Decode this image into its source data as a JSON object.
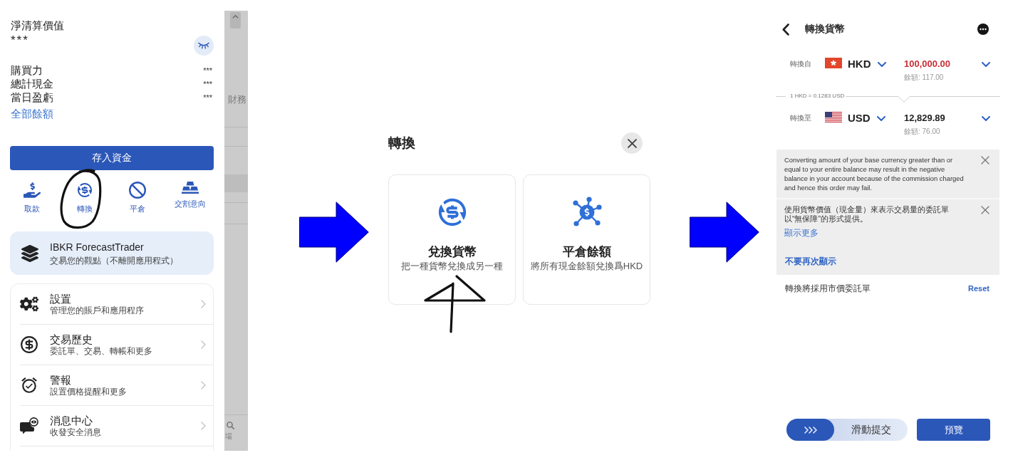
{
  "account_drawer": {
    "title": "淨清算價值",
    "masked_value": "***",
    "balances": [
      {
        "label": "購買力",
        "value": "***"
      },
      {
        "label": "總計現金",
        "value": "***"
      },
      {
        "label": "當日盈虧",
        "value": "***"
      }
    ],
    "all_balances_link": "全部餘額",
    "deposit_button": "存入資金",
    "actions": [
      {
        "label": "取款"
      },
      {
        "label": "轉換"
      },
      {
        "label": "平倉"
      },
      {
        "label": "交割意向"
      }
    ],
    "promo": {
      "title": "IBKR ForecastTrader",
      "subtitle": "交易您的觀點（不離開應用程式）"
    },
    "menu": [
      {
        "title": "設置",
        "subtitle": "管理您的賬戶和應用程序"
      },
      {
        "title": "交易歷史",
        "subtitle": "委託單、交易、轉帳和更多"
      },
      {
        "title": "警報",
        "subtitle": "設置價格提醒和更多"
      },
      {
        "title": "消息中心",
        "subtitle": "收發安全消息"
      }
    ]
  },
  "background_screen": {
    "column_label": "財務",
    "tab_label": "場"
  },
  "convert_dialog": {
    "title": "轉換",
    "options": [
      {
        "title": "兌換貨幣",
        "subtitle": "把一種貨幣兌換成另一種"
      },
      {
        "title": "平倉餘額",
        "subtitle": "將所有現金餘額兌換爲HKD"
      }
    ]
  },
  "currency_conversion": {
    "title": "轉換貨幣",
    "from": {
      "label": "轉換自",
      "currency": "HKD",
      "amount": "100,000.00",
      "over_balance": true,
      "balance": "餘額: 117.00"
    },
    "rate": "1 HKD = 0.1283 USD",
    "to": {
      "label": "轉換至",
      "currency": "USD",
      "amount": "12,829.89",
      "over_balance": false,
      "balance": "餘額: 76.00"
    },
    "notices": [
      {
        "text": "Converting amount of your base currency greater than or equal to your entire balance may result in the negative balance in your account because of the commission charged and hence this order may fail."
      },
      {
        "text": "使用貨幣價值（現金量）來表示交易量的委託單以“無保障”的形式提供。",
        "link": "顯示更多"
      }
    ],
    "dont_show_again": "不要再次顯示",
    "order_type_note": "轉換將採用市價委託單",
    "reset": "Reset",
    "slide_submit": "滑動提交",
    "preview_button": "預覽"
  }
}
